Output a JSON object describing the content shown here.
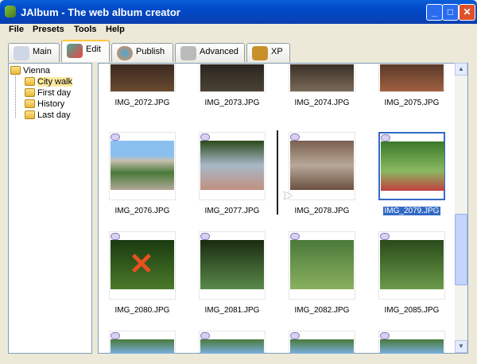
{
  "window": {
    "title": "JAlbum - The web album creator"
  },
  "menu": [
    "File",
    "Presets",
    "Tools",
    "Help"
  ],
  "tabs": [
    {
      "label": "Main"
    },
    {
      "label": "Edit"
    },
    {
      "label": "Publish"
    },
    {
      "label": "Advanced"
    },
    {
      "label": "XP"
    }
  ],
  "tree": {
    "root": "Vienna",
    "children": [
      "City walk",
      "First day",
      "History",
      "Last day"
    ],
    "selected": "City walk"
  },
  "images": [
    "IMG_2072.JPG",
    "IMG_2073.JPG",
    "IMG_2074.JPG",
    "IMG_2075.JPG",
    "IMG_2076.JPG",
    "IMG_2077.JPG",
    "IMG_2078.JPG",
    "IMG_2079.JPG",
    "IMG_2080.JPG",
    "IMG_2081.JPG",
    "IMG_2082.JPG",
    "IMG_2085.JPG"
  ],
  "selected_image": "IMG_2079.JPG",
  "colors": {
    "selection": "#316ac5",
    "titlebar": "#0a5fd8"
  }
}
